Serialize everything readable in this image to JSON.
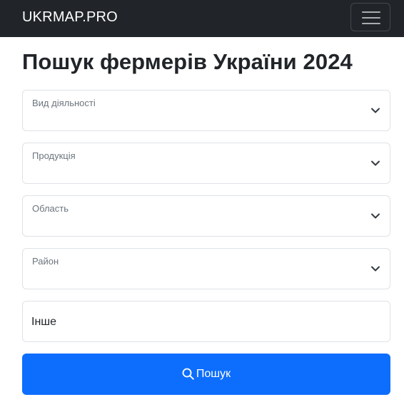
{
  "navbar": {
    "brand": "UKRMAP.PRO",
    "menu_icon": "hamburger-menu-icon"
  },
  "page": {
    "title": "Пошук фермерів України 2024"
  },
  "form": {
    "fields": [
      {
        "label": "Вид діяльності",
        "value": "",
        "icon": "chevron-down-icon"
      },
      {
        "label": "Продукція",
        "value": "",
        "icon": "chevron-down-icon"
      },
      {
        "label": "Область",
        "value": "",
        "icon": "chevron-down-icon"
      },
      {
        "label": "Район",
        "value": "",
        "icon": "chevron-down-icon"
      }
    ],
    "other_input": {
      "value": "Інше"
    },
    "search_button": {
      "label": "Пошук",
      "icon": "search-icon"
    }
  },
  "colors": {
    "navbar_bg": "#212529",
    "primary": "#0d6efd",
    "border": "#dee2e6",
    "label": "#6c757d"
  }
}
